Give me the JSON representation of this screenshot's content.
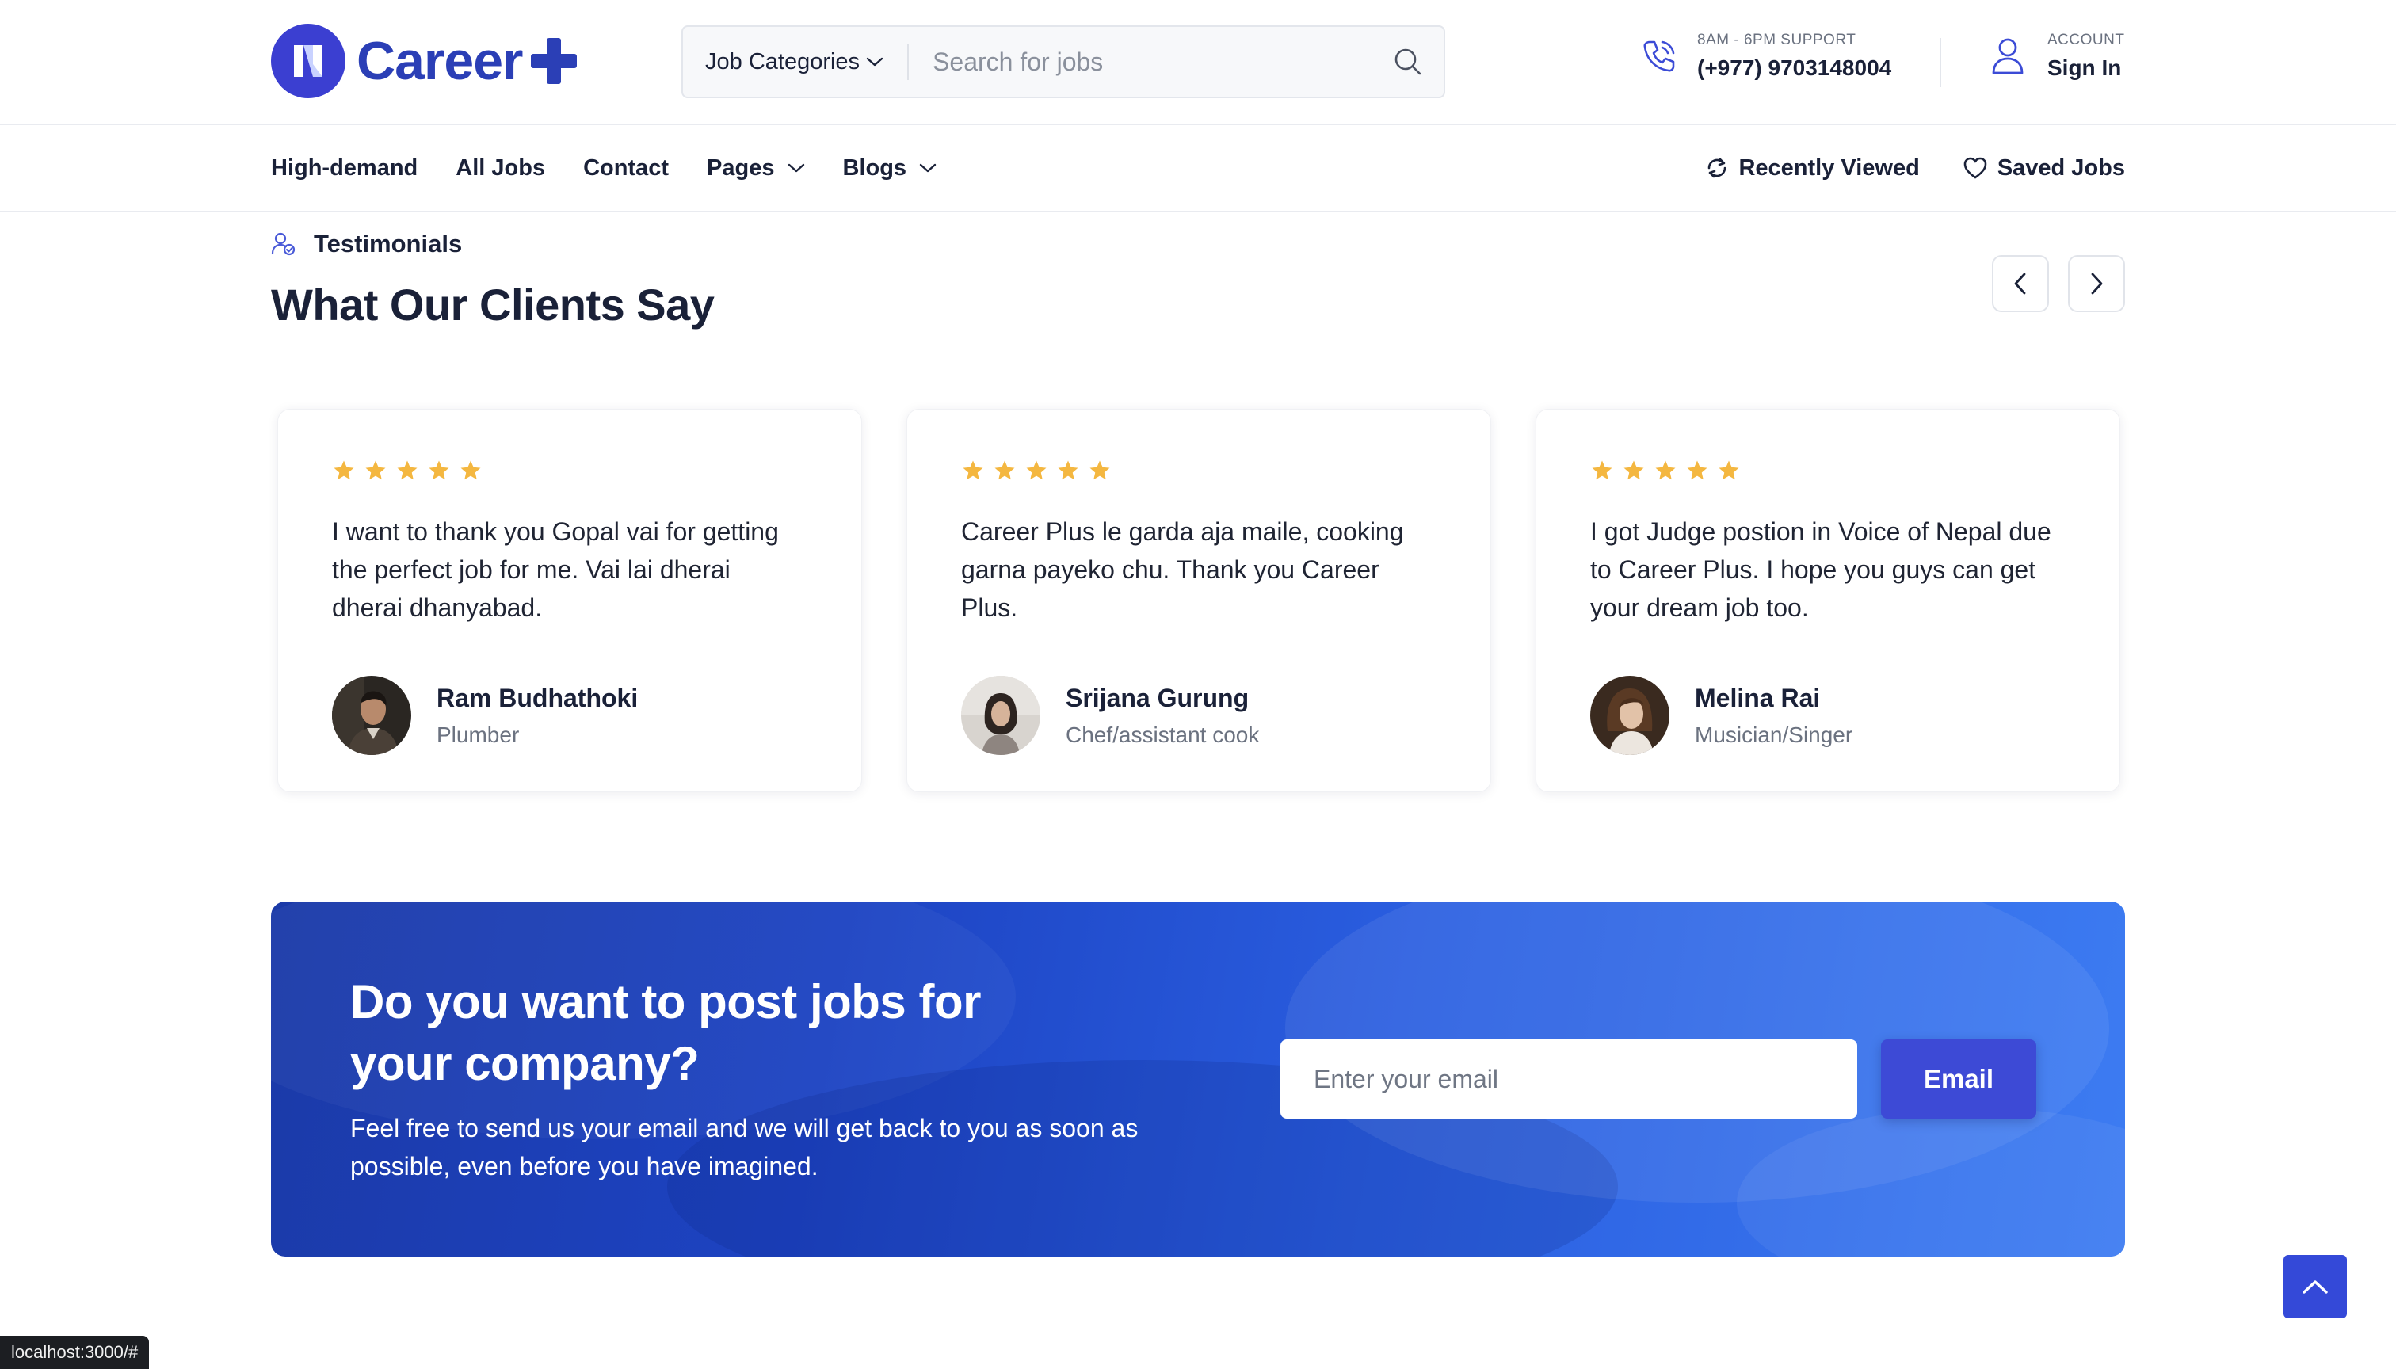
{
  "header": {
    "logo_text": "Career",
    "search": {
      "category_label": "Job Categories",
      "placeholder": "Search for jobs"
    },
    "support": {
      "label": "8AM - 6PM SUPPORT",
      "phone": "(+977) 9703148004"
    },
    "account": {
      "label": "ACCOUNT",
      "link": "Sign In"
    }
  },
  "nav": {
    "items": [
      {
        "label": "High-demand"
      },
      {
        "label": "All Jobs"
      },
      {
        "label": "Contact"
      },
      {
        "label": "Pages"
      },
      {
        "label": "Blogs"
      }
    ],
    "right": {
      "recently_viewed": "Recently Viewed",
      "saved_jobs": "Saved Jobs"
    }
  },
  "testimonials": {
    "tag": "Testimonials",
    "title": "What Our Clients Say",
    "cards": [
      {
        "rating": 5,
        "quote": "I want to thank you Gopal vai for getting the perfect job for me. Vai lai dherai dherai dhanyabad.",
        "name": "Ram Budhathoki",
        "role": "Plumber"
      },
      {
        "rating": 5,
        "quote": "Career Plus le garda aja maile, cooking garna payeko chu. Thank you Career Plus.",
        "name": "Srijana Gurung",
        "role": "Chef/assistant cook"
      },
      {
        "rating": 5,
        "quote": "I got Judge postion in Voice of Nepal due to Career Plus. I hope you guys can get your dream job too.",
        "name": "Melina Rai",
        "role": "Musician/Singer"
      }
    ]
  },
  "cta": {
    "title": "Do you want to post jobs for your company?",
    "subtitle": "Feel free to send us your email and we will get back to you as soon as possible, even before you have imagined.",
    "email_placeholder": "Enter your email",
    "button_label": "Email"
  },
  "status_bar": {
    "url": "localhost:3000/#"
  },
  "colors": {
    "brand": "#2b3fb6",
    "accent": "#3d4ad6",
    "star": "#f4b740",
    "text": "#1a2138"
  }
}
